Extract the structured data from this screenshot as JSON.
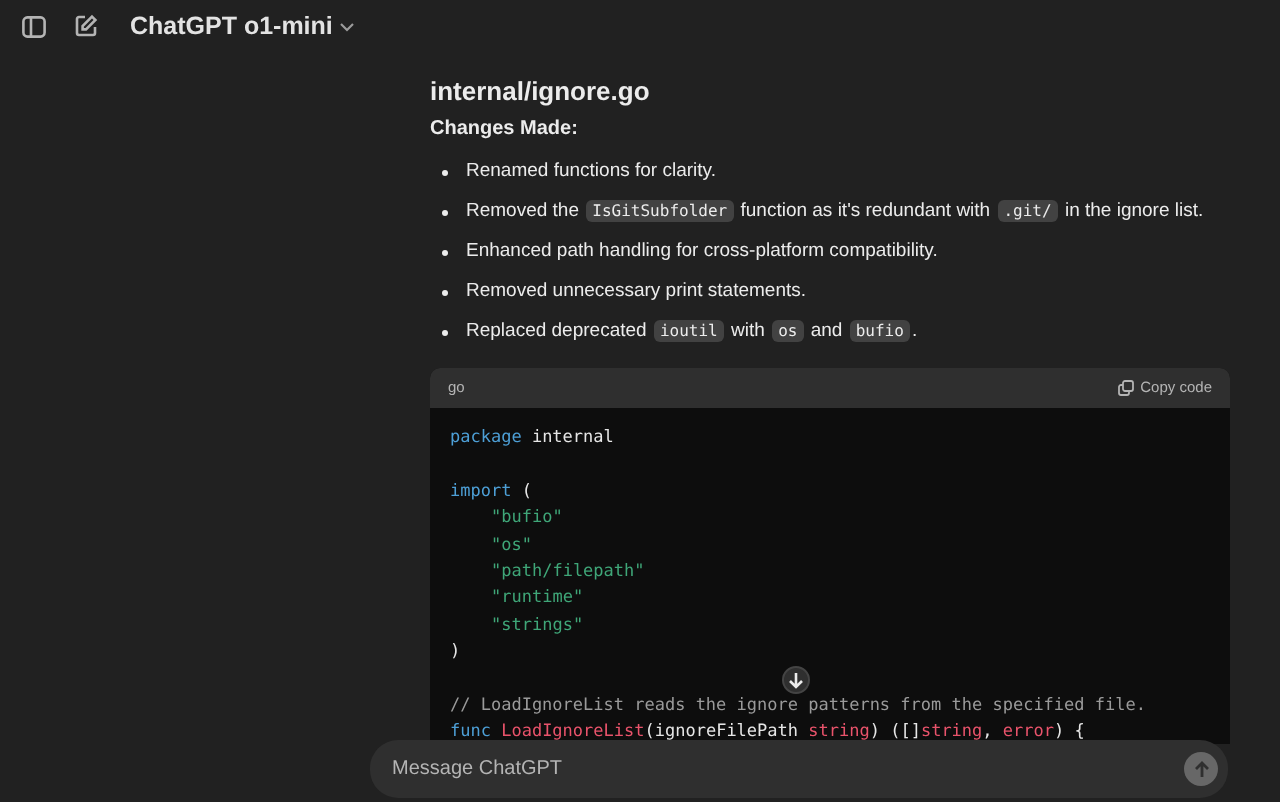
{
  "header": {
    "model": "ChatGPT o1-mini"
  },
  "message": {
    "heading": "internal/ignore.go",
    "subheading": "Changes Made:",
    "bullets": [
      [
        {
          "kind": "text",
          "text": "Renamed functions for clarity."
        }
      ],
      [
        {
          "kind": "text",
          "text": "Removed the"
        },
        {
          "kind": "code",
          "text": "IsGitSubfolder"
        },
        {
          "kind": "text",
          "text": "function as it's redundant with"
        },
        {
          "kind": "code",
          "text": ".git/"
        },
        {
          "kind": "text",
          "text": "in the ignore list."
        }
      ],
      [
        {
          "kind": "text",
          "text": "Enhanced path handling for cross-platform compatibility."
        }
      ],
      [
        {
          "kind": "text",
          "text": "Removed unnecessary print statements."
        }
      ],
      [
        {
          "kind": "text",
          "text": "Replaced deprecated"
        },
        {
          "kind": "code",
          "text": "ioutil"
        },
        {
          "kind": "text",
          "text": "with"
        },
        {
          "kind": "code",
          "text": "os"
        },
        {
          "kind": "text",
          "text": "and"
        },
        {
          "kind": "code",
          "text": "bufio"
        },
        {
          "kind": "text",
          "text": "."
        }
      ]
    ],
    "code_block": {
      "language": "go",
      "copy_label": "Copy code",
      "lines": [
        {
          "kind": "code",
          "tokens": [
            {
              "kind": "keyword",
              "text": "package"
            },
            {
              "kind": "plain",
              "text": " internal"
            }
          ]
        },
        {
          "kind": "blank"
        },
        {
          "kind": "code",
          "tokens": [
            {
              "kind": "keyword",
              "text": "import"
            },
            {
              "kind": "plain",
              "text": " ("
            }
          ]
        },
        {
          "kind": "code",
          "indent": true,
          "tokens": [
            {
              "kind": "string",
              "text": "\"bufio\""
            }
          ]
        },
        {
          "kind": "code",
          "indent": true,
          "tokens": [
            {
              "kind": "string",
              "text": "\"os\""
            }
          ]
        },
        {
          "kind": "code",
          "indent": true,
          "tokens": [
            {
              "kind": "string",
              "text": "\"path/filepath\""
            }
          ]
        },
        {
          "kind": "code",
          "indent": true,
          "tokens": [
            {
              "kind": "string",
              "text": "\"runtime\""
            }
          ]
        },
        {
          "kind": "code",
          "indent": true,
          "tokens": [
            {
              "kind": "string",
              "text": "\"strings\""
            }
          ]
        },
        {
          "kind": "code",
          "tokens": [
            {
              "kind": "plain",
              "text": ")"
            }
          ]
        },
        {
          "kind": "blank"
        },
        {
          "kind": "code",
          "tokens": [
            {
              "kind": "comment",
              "text": "// LoadIgnoreList reads the ignore patterns from the specified file."
            }
          ]
        },
        {
          "kind": "code",
          "tokens": [
            {
              "kind": "keyword",
              "text": "func "
            },
            {
              "kind": "name",
              "text": "LoadIgnoreList"
            },
            {
              "kind": "plain",
              "text": "(ignoreFilePath "
            },
            {
              "kind": "type",
              "text": "string"
            },
            {
              "kind": "plain",
              "text": ") ([]"
            },
            {
              "kind": "type",
              "text": "string"
            },
            {
              "kind": "plain",
              "text": ", "
            },
            {
              "kind": "type",
              "text": "error"
            },
            {
              "kind": "plain",
              "text": ") {"
            }
          ]
        }
      ]
    }
  },
  "composer": {
    "placeholder": "Message ChatGPT"
  }
}
